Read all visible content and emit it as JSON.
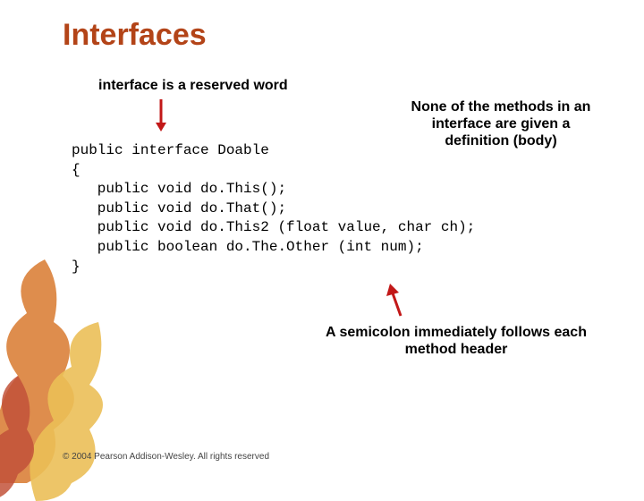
{
  "title": "Interfaces",
  "annotation1_kw": "interface",
  "annotation1_rest": " is a reserved word",
  "annotation2": "None of the methods in an interface are given a definition (body)",
  "code": "public interface Doable\n{\n   public void do.This();\n   public void do.That();\n   public void do.This2 (float value, char ch);\n   public boolean do.The.Other (int num);\n}",
  "annotation3": "A semicolon immediately follows each method header",
  "footer": "© 2004 Pearson Addison-Wesley. All rights reserved",
  "colors": {
    "accent_red": "#c21818",
    "title": "#b34418"
  }
}
